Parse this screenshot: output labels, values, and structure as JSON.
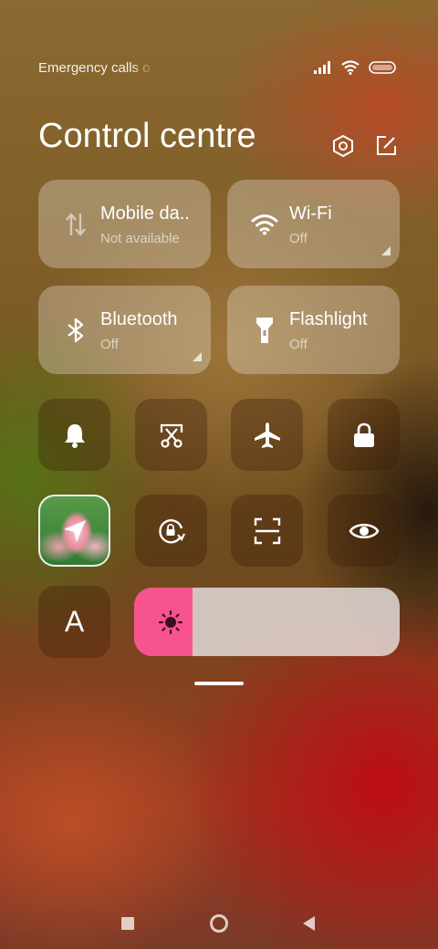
{
  "status_bar": {
    "carrier_text": "Emergency calls o",
    "signal_icon": "signal-bars-icon",
    "wifi_icon": "wifi-icon",
    "battery_icon": "battery-icon"
  },
  "header": {
    "title": "Control centre",
    "settings_icon": "settings-hexagon-icon",
    "edit_icon": "edit-icon"
  },
  "big_tiles": [
    {
      "label": "Mobile da..",
      "sub": "Not available",
      "icon": "mobile-data-icon",
      "expand": false
    },
    {
      "label": "Wi-Fi",
      "sub": "Off",
      "icon": "wifi-icon",
      "expand": true
    },
    {
      "label": "Bluetooth",
      "sub": "Off",
      "icon": "bluetooth-icon",
      "expand": true
    },
    {
      "label": "Flashlight",
      "sub": "Off",
      "icon": "flashlight-icon",
      "expand": false
    }
  ],
  "small_tiles_row1": [
    "bell-icon",
    "screenshot-scissors-icon",
    "airplane-icon",
    "lock-icon"
  ],
  "small_tiles_row2": [
    "location-icon",
    "rotation-lock-icon",
    "scan-icon",
    "eye-icon"
  ],
  "font_tile": {
    "label": "A"
  },
  "brightness": {
    "level": 0.22,
    "icon": "sun-icon",
    "fill_color": "#f7548f"
  },
  "nav": [
    "recents-square-icon",
    "home-circle-icon",
    "back-triangle-icon"
  ]
}
